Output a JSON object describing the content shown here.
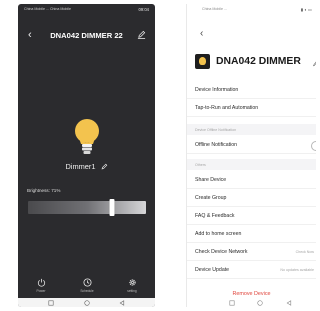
{
  "left_screen": {
    "status_left": "China Mobile  ...  China Mobile",
    "status_right": "09:04",
    "title": "DNA042 DIMMER 22",
    "device_name": "Dimmer1",
    "brightness_label": "Brightness: 71%",
    "brightness_value": 0.71,
    "dock": [
      {
        "label": "Power",
        "icon": "power-icon"
      },
      {
        "label": "Schedule",
        "icon": "clock-icon"
      },
      {
        "label": "setting",
        "icon": "gear-icon"
      }
    ],
    "colors": {
      "background": "#2b2b2e",
      "bulb": "#f3c34e"
    }
  },
  "right_screen": {
    "status_left": "China Mobile  ...",
    "title": "DNA042 DIMMER",
    "menu": {
      "device_information": "Device Information",
      "tap_to_run": "Tap-to-Run and Automation",
      "offline_section": "Device Offline Notification",
      "offline_notification": "Offline Notification",
      "others_section": "Others",
      "share_device": "Share Device",
      "create_group": "Create Group",
      "faq": "FAQ & Feedback",
      "add_home": "Add to home screen",
      "check_network": "Check Device Network",
      "check_now": "Check Now",
      "device_update": "Device Update",
      "no_updates": "No updates available"
    },
    "remove_device": "Remove Device",
    "colors": {
      "remove": "#e0443b"
    }
  }
}
